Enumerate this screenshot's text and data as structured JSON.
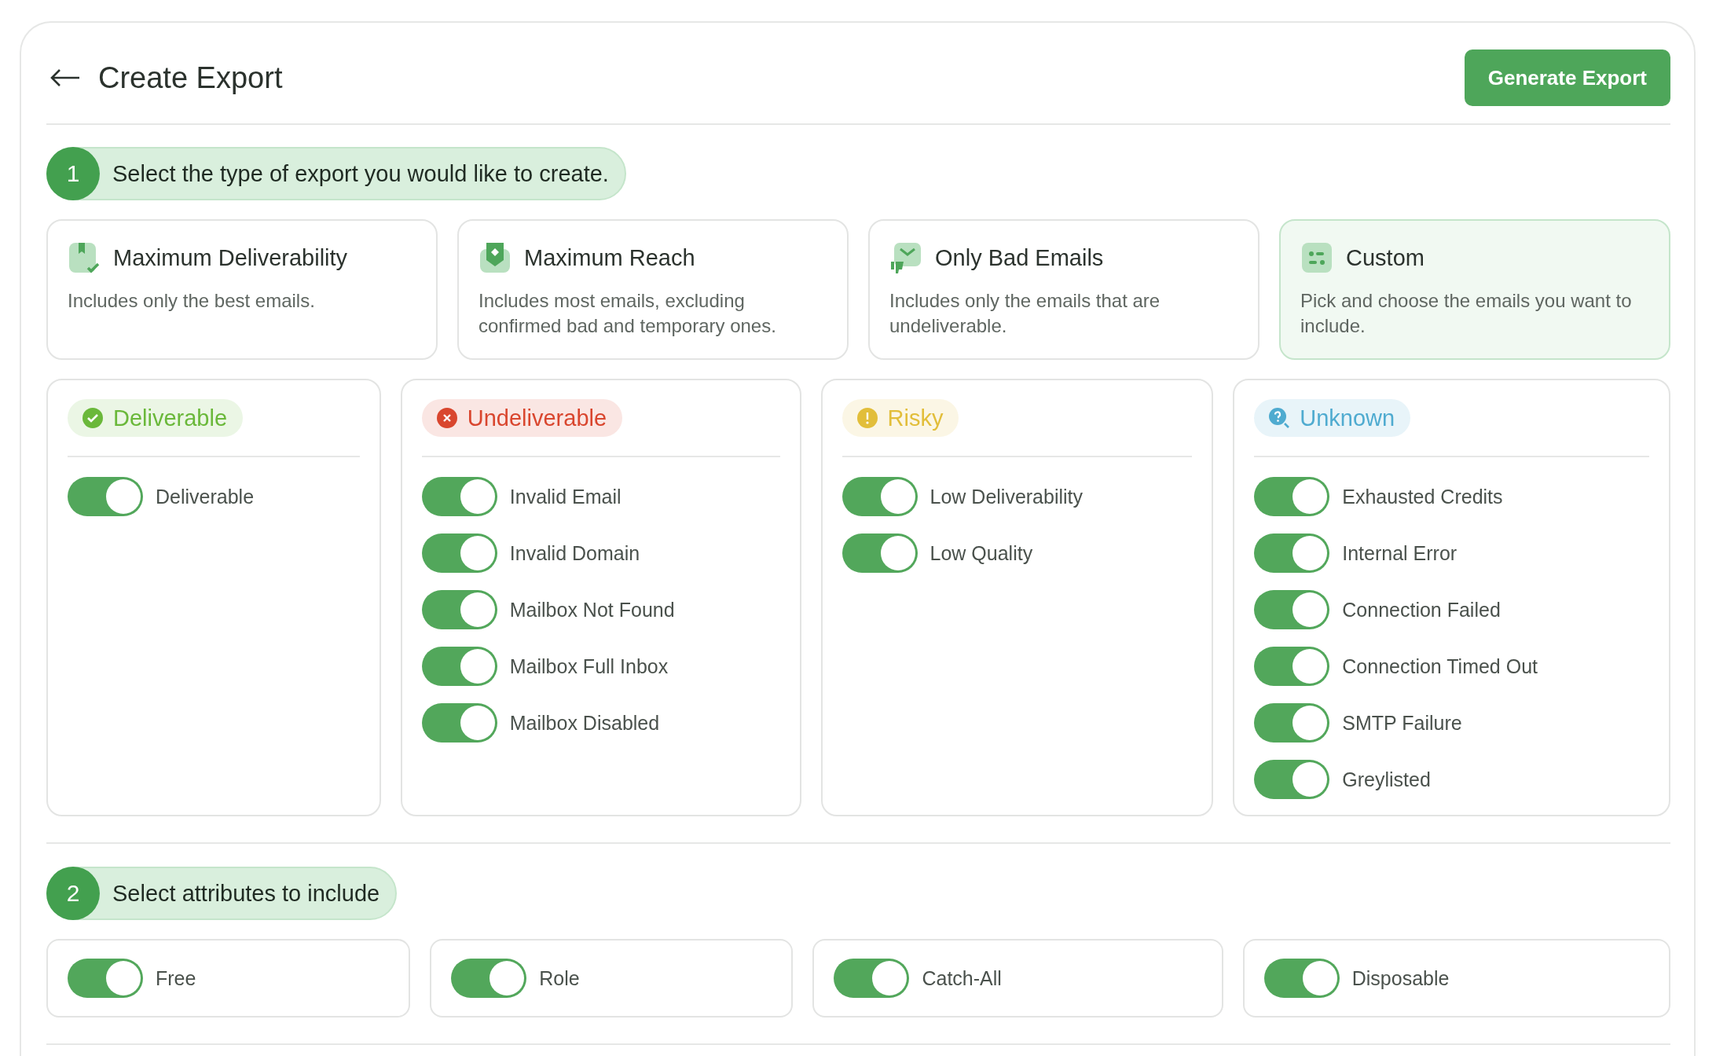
{
  "header": {
    "title": "Create Export",
    "action": "Generate Export"
  },
  "step1": {
    "number": "1",
    "label": "Select the type of export you would like to create."
  },
  "export_types": [
    {
      "kind": "deliverability",
      "title": "Maximum Deliverability",
      "description": "Includes only the best emails.",
      "selected": false
    },
    {
      "kind": "reach",
      "title": "Maximum Reach",
      "description": "Includes most emails, excluding confirmed bad and temporary ones.",
      "selected": false
    },
    {
      "kind": "bad",
      "title": "Only Bad Emails",
      "description": "Includes only the emails that are undeliverable.",
      "selected": false
    },
    {
      "kind": "custom",
      "title": "Custom",
      "description": "Pick and choose the emails you want to include.",
      "selected": true
    }
  ],
  "categories": [
    {
      "kind": "check",
      "label": "Deliverable",
      "color": "#6ab83a",
      "items": [
        {
          "label": "Deliverable",
          "on": true
        }
      ]
    },
    {
      "kind": "cross",
      "label": "Undeliverable",
      "color": "#d9462e",
      "items": [
        {
          "label": "Invalid Email",
          "on": true
        },
        {
          "label": "Invalid Domain",
          "on": true
        },
        {
          "label": "Mailbox Not Found",
          "on": true
        },
        {
          "label": "Mailbox Full Inbox",
          "on": true
        },
        {
          "label": "Mailbox Disabled",
          "on": true
        }
      ]
    },
    {
      "kind": "warning",
      "label": "Risky",
      "color": "#e2be3a",
      "items": [
        {
          "label": "Low Deliverability",
          "on": true
        },
        {
          "label": "Low Quality",
          "on": true
        }
      ]
    },
    {
      "kind": "question",
      "label": "Unknown",
      "color": "#4fabd0",
      "items": [
        {
          "label": "Exhausted Credits",
          "on": true
        },
        {
          "label": "Internal Error",
          "on": true
        },
        {
          "label": "Connection Failed",
          "on": true
        },
        {
          "label": "Connection Timed Out",
          "on": true
        },
        {
          "label": "SMTP Failure",
          "on": true
        },
        {
          "label": "Greylisted",
          "on": true
        }
      ]
    }
  ],
  "step2": {
    "number": "2",
    "label": "Select attributes to include"
  },
  "attributes": [
    {
      "label": "Free",
      "on": true
    },
    {
      "label": "Role",
      "on": true
    },
    {
      "label": "Catch-All",
      "on": true
    },
    {
      "label": "Disposable",
      "on": true
    }
  ]
}
